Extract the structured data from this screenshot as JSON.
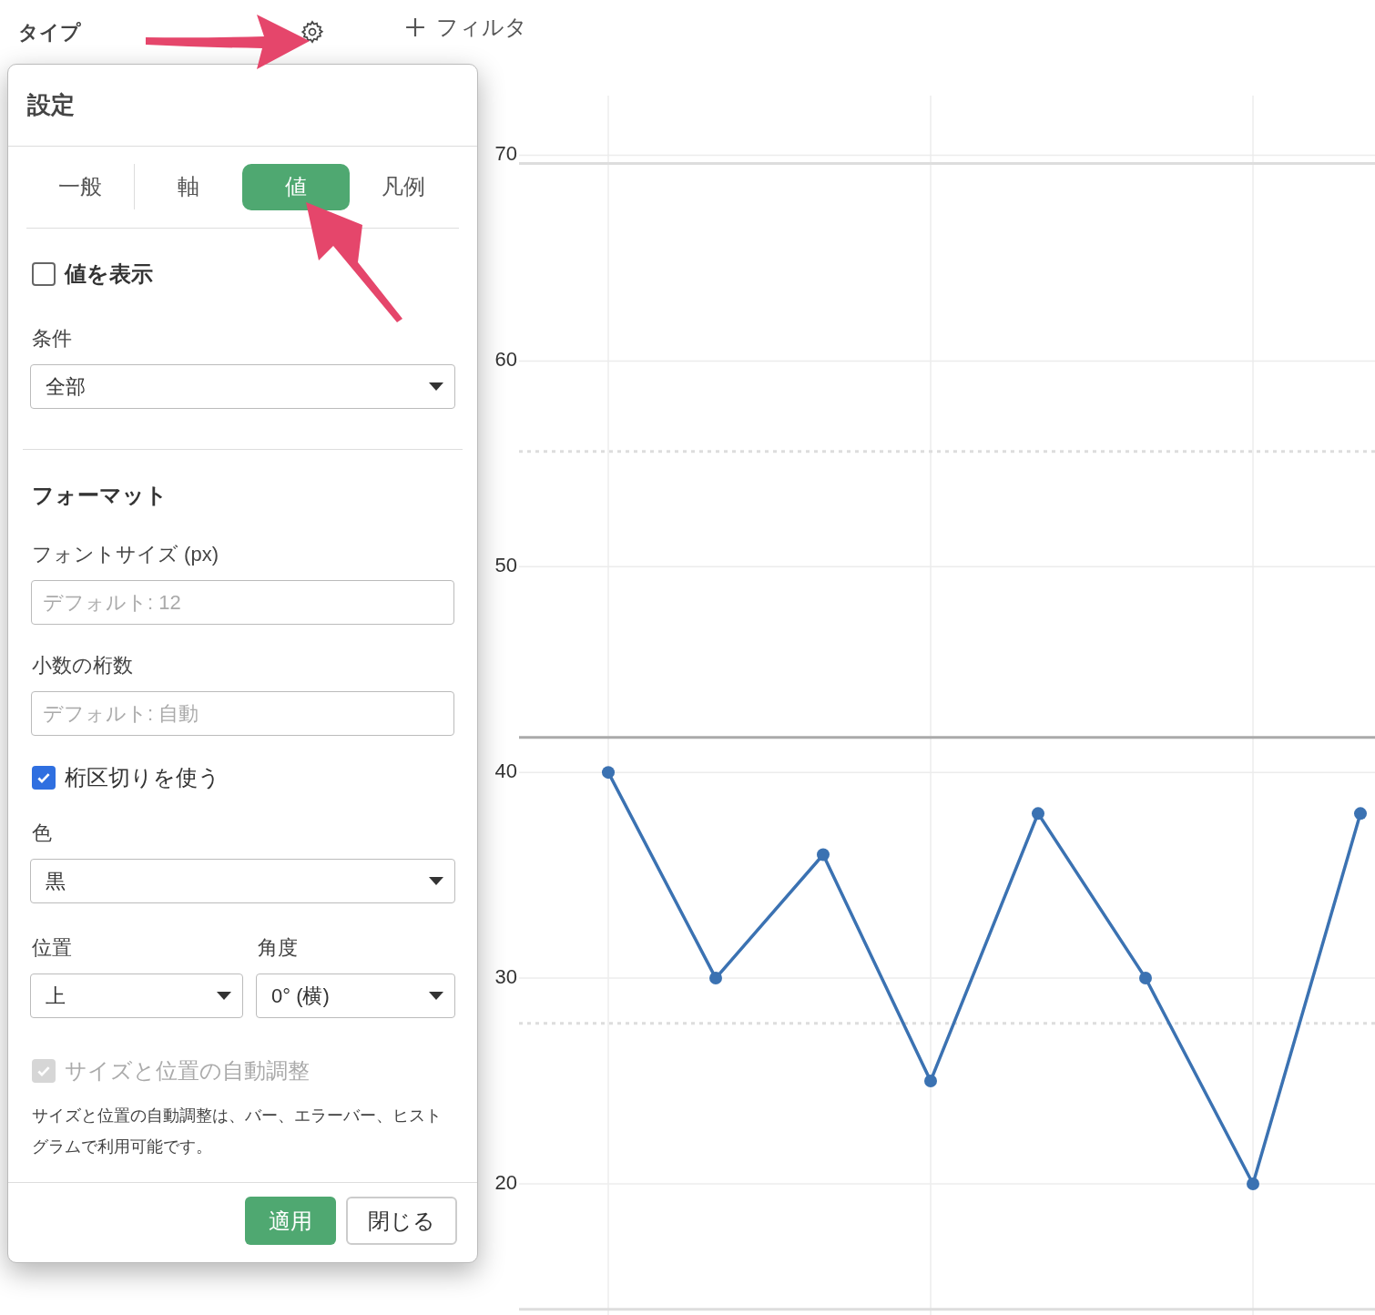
{
  "toolbar": {
    "type_label": "タイプ",
    "filter_button": "フィルタ"
  },
  "dialog": {
    "title": "設定",
    "tabs": [
      {
        "label": "一般",
        "selected": false
      },
      {
        "label": "軸",
        "selected": false
      },
      {
        "label": "値",
        "selected": true
      },
      {
        "label": "凡例",
        "selected": false
      }
    ],
    "show_values": {
      "label": "値を表示",
      "checked": false
    },
    "condition": {
      "label": "条件",
      "value": "全部"
    },
    "format_heading": "フォーマット",
    "font_size": {
      "label": "フォントサイズ (px)",
      "placeholder": "デフォルト: 12"
    },
    "decimals": {
      "label": "小数の桁数",
      "placeholder": "デフォルト: 自動"
    },
    "separator": {
      "label": "桁区切りを使う",
      "checked": true
    },
    "color": {
      "label": "色",
      "value": "黒"
    },
    "position": {
      "label": "位置",
      "value": "上"
    },
    "angle": {
      "label": "角度",
      "value": "0° (横)"
    },
    "auto_adjust": {
      "label": "サイズと位置の自動調整",
      "checked": true,
      "disabled": true
    },
    "note": "サイズと位置の自動調整は、バー、エラーバー、ヒストグラムで利用可能です。",
    "buttons": [
      {
        "label": "適用",
        "kind": "primary"
      },
      {
        "label": "閉じる",
        "kind": "secondary"
      }
    ]
  },
  "chart": {
    "chart_data": {
      "type": "line",
      "categories": [
        null,
        null,
        null,
        null,
        null,
        null,
        null,
        null
      ],
      "series": [
        {
          "color": "#3b72b2",
          "marker": "circle",
          "values": [
            40,
            30,
            36,
            25,
            38,
            30,
            20,
            38
          ]
        }
      ],
      "ylim": [
        13.8,
        72.9
      ],
      "yticks": [
        20,
        30,
        40,
        50,
        60,
        70
      ],
      "grid": true,
      "ref_lines": [
        {
          "axis": "y",
          "value": 69.6
        },
        {
          "axis": "y",
          "value": 55.6
        },
        {
          "axis": "y",
          "value": 41.7
        },
        {
          "axis": "y",
          "value": 27.8
        },
        {
          "axis": "y",
          "value": 13.9
        }
      ]
    }
  }
}
